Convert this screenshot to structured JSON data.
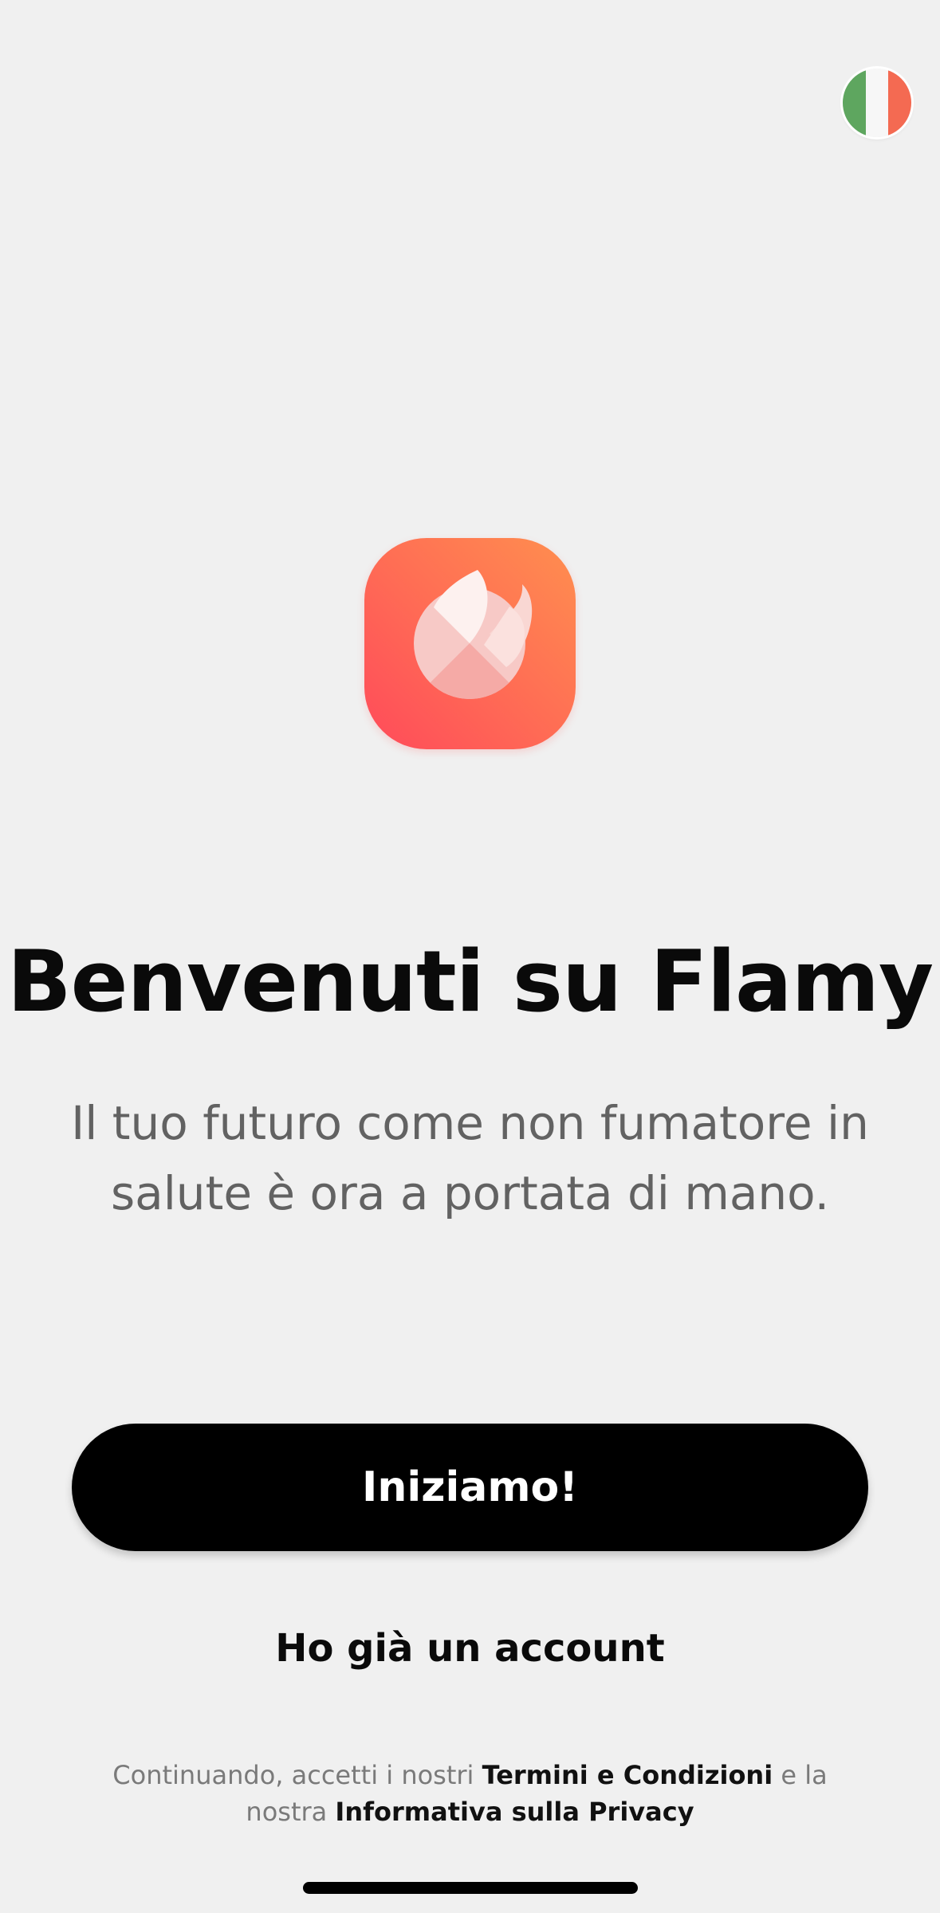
{
  "language": {
    "flag": "italy-flag",
    "colors": [
      "#5ea65f",
      "#f7f7f7",
      "#f46a52"
    ]
  },
  "app_icon": {
    "name": "flamy-flame-icon",
    "gradient": [
      "#ff4a5a",
      "#ff8f4f"
    ]
  },
  "welcome": {
    "title": "Benvenuti su Flamy",
    "subtitle": "Il tuo futuro come non fumatore in salute è ora a portata di mano."
  },
  "actions": {
    "start_label": "Iniziamo!",
    "login_label": "Ho già un account"
  },
  "legal": {
    "prefix": "Continuando, accetti i nostri",
    "terms_link": "Termini e Condizioni",
    "middle": "e la nostra",
    "privacy_link": "Informativa sulla Privacy"
  }
}
